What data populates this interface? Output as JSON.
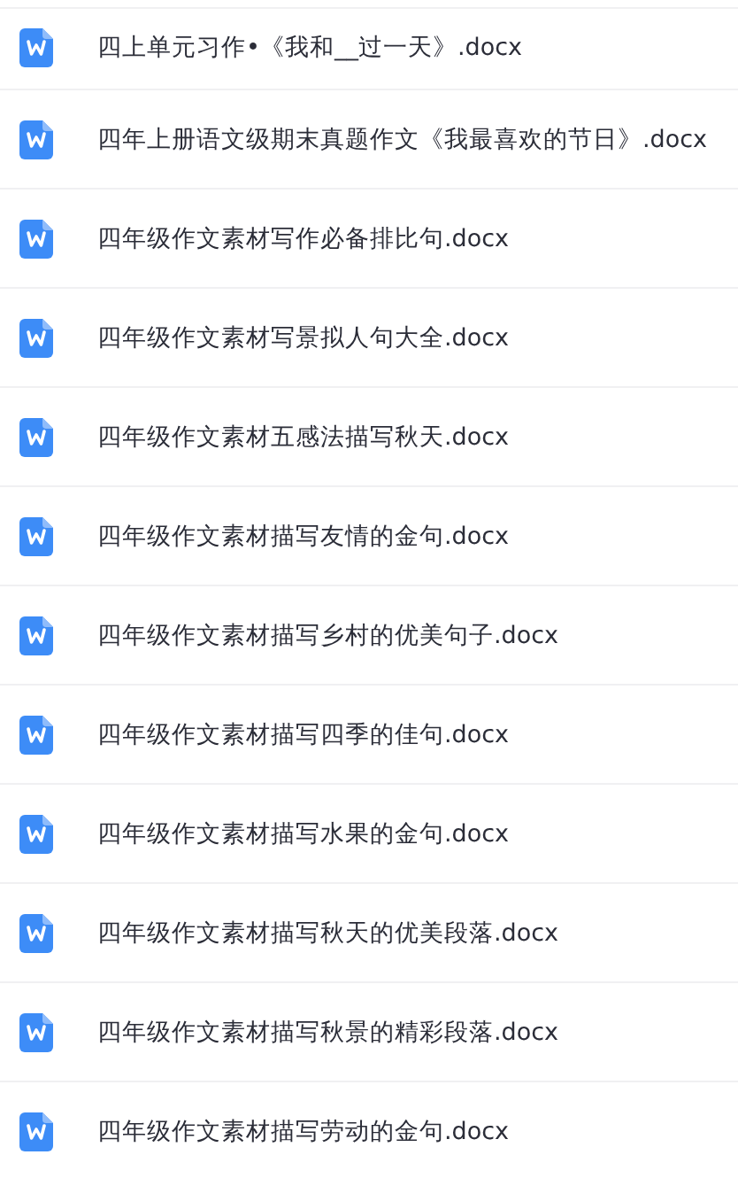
{
  "files": [
    {
      "name": "四上单元习作•《我和__过一天》.docx"
    },
    {
      "name": "四年上册语文级期末真题作文《我最喜欢的节日》.docx"
    },
    {
      "name": "四年级作文素材写作必备排比句.docx"
    },
    {
      "name": "四年级作文素材写景拟人句大全.docx"
    },
    {
      "name": "四年级作文素材五感法描写秋天.docx"
    },
    {
      "name": "四年级作文素材描写友情的金句.docx"
    },
    {
      "name": "四年级作文素材描写乡村的优美句子.docx"
    },
    {
      "name": "四年级作文素材描写四季的佳句.docx"
    },
    {
      "name": "四年级作文素材描写水果的金句.docx"
    },
    {
      "name": "四年级作文素材描写秋天的优美段落.docx"
    },
    {
      "name": "四年级作文素材描写秋景的精彩段落.docx"
    },
    {
      "name": "四年级作文素材描写劳动的金句.docx"
    }
  ]
}
